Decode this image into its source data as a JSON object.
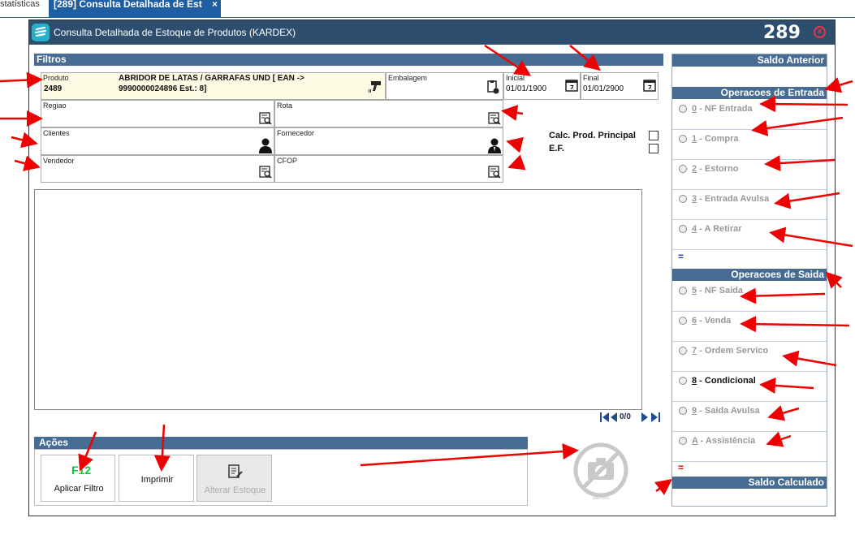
{
  "tabs": {
    "prev_label": "statísticas",
    "active_label": "[289] Consulta Detalhada de Est",
    "close_glyph": "×"
  },
  "window": {
    "title": "Consulta Detalhada de Estoque de Produtos (KARDEX)",
    "number": "289",
    "close_glyph": "×"
  },
  "filtros": {
    "header": "Filtros",
    "produto_label": "Produto",
    "produto_code": "2489",
    "produto_desc_line1": "ABRIDOR DE LATAS / GARRAFAS UND [ EAN ->",
    "produto_desc_line2": "9990000024896 Est.: 8]",
    "embalagem_label": "Embalagem",
    "inicial_label": "Inicial",
    "inicial_value": "01/01/1900",
    "final_label": "Final",
    "final_value": "01/01/2900",
    "regiao_label": "Regiao",
    "rota_label": "Rota",
    "clientes_label": "Clientes",
    "fornecedor_label": "Fornecedor",
    "vendedor_label": "Vendedor",
    "cfop_label": "CFOP",
    "calc_label": "Calc. Prod. Principal",
    "ef_label": "E.F."
  },
  "pager": {
    "text": "0/0"
  },
  "acoes": {
    "header": "Ações",
    "aplicar_label": "Aplicar Filtro",
    "aplicar_key": "F12",
    "imprimir_label": "Imprimir",
    "alterar_label": "Alterar Estoque"
  },
  "photo": {
    "caption": "SEM FOTO"
  },
  "right_panel": {
    "saldo_anterior": "Saldo Anterior",
    "entrada_header": "Operacoes de Entrada",
    "entrada_items": [
      {
        "key": "0",
        "label": " - NF Entrada"
      },
      {
        "key": "1",
        "label": " - Compra"
      },
      {
        "key": "2",
        "label": " - Estorno"
      },
      {
        "key": "3",
        "label": " - Entrada Avulsa"
      },
      {
        "key": "4",
        "label": " - A Retirar"
      }
    ],
    "equals_sign": "=",
    "saida_header": "Operacoes de Saida",
    "saida_items": [
      {
        "key": "5",
        "label": " - NF Saida"
      },
      {
        "key": "6",
        "label": " - Venda"
      },
      {
        "key": "7",
        "label": " - Ordem Servico"
      },
      {
        "key": "8",
        "label": " - Condicional"
      },
      {
        "key": "9",
        "label": " - Saida Avulsa"
      },
      {
        "key": "A",
        "label": " - Assistência"
      }
    ],
    "equals_sign2": "=",
    "saldo_calculado": "Saldo Calculado"
  },
  "colors": {
    "header_bg": "#466c94",
    "titlebar_bg": "#2e4e6f",
    "tab_bg": "#1f5ea0",
    "annotation_arrows": "#e00000",
    "accent_key": "#00cc33"
  }
}
